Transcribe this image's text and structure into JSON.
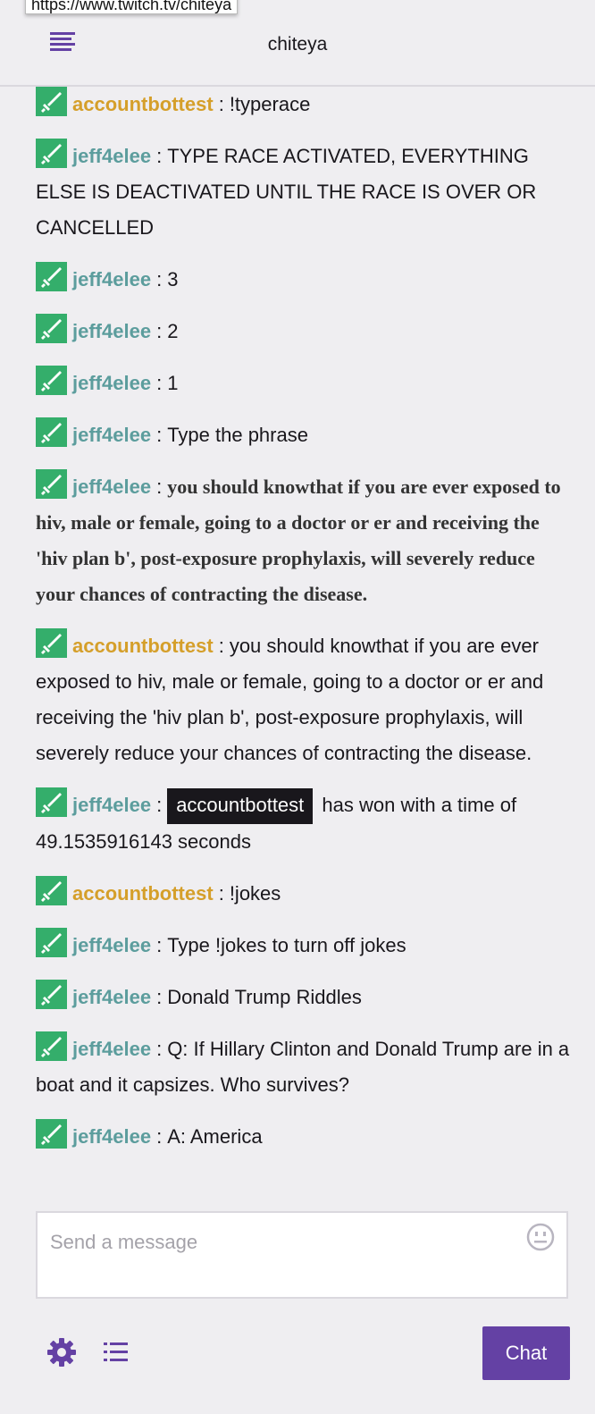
{
  "browser": {
    "url_tooltip": "https://www.twitch.tv/chiteya"
  },
  "header": {
    "channel": "chiteya",
    "menu_icon": "hamburger-menu-icon"
  },
  "colors": {
    "accent": "#6441a4",
    "badge": "#34ae6b",
    "user_teal": "#5c9d9d",
    "user_gold": "#d59f2a"
  },
  "messages": [
    {
      "user": "accountbottest",
      "text": "!typerace"
    },
    {
      "user": "jeff4elee",
      "text": "TYPE RACE ACTIVATED, EVERYTHING ELSE IS DEACTIVATED UNTIL THE RACE IS OVER OR CANCELLED"
    },
    {
      "user": "jeff4elee",
      "text": "3"
    },
    {
      "user": "jeff4elee",
      "text": "2"
    },
    {
      "user": "jeff4elee",
      "text": "1"
    },
    {
      "user": "jeff4elee",
      "text": "Type the phrase"
    },
    {
      "user": "jeff4elee",
      "text": "you should knowthat if you are ever exposed to hiv, male or female, going to a doctor or er and receiving the 'hiv plan b', post-exposure prophylaxis, will severely reduce your chances of contracting the disease."
    },
    {
      "user": "accountbottest",
      "text": "you should knowthat if you are ever exposed to hiv, male or female, going to a doctor or er and receiving the 'hiv plan b', post-exposure prophylaxis, will severely reduce your chances of contracting the disease."
    },
    {
      "user": "jeff4elee",
      "mention": "accountbottest",
      "text": "has won with a time of 49.1535916143 seconds"
    },
    {
      "user": "accountbottest",
      "text": "!jokes"
    },
    {
      "user": "jeff4elee",
      "text": "Type !jokes to turn off jokes"
    },
    {
      "user": "jeff4elee",
      "text": "Donald Trump Riddles"
    },
    {
      "user": "jeff4elee",
      "text": "Q: If Hillary Clinton and Donald Trump are in a boat and it capsizes. Who survives?"
    },
    {
      "user": "jeff4elee",
      "text": "A: America"
    }
  ],
  "colon": ":",
  "input": {
    "placeholder": "Send a message",
    "value": "",
    "emoji_icon": "emoji-face-icon"
  },
  "footer": {
    "settings_icon": "gear-icon",
    "viewer_list_icon": "list-icon",
    "chat_button": "Chat"
  }
}
